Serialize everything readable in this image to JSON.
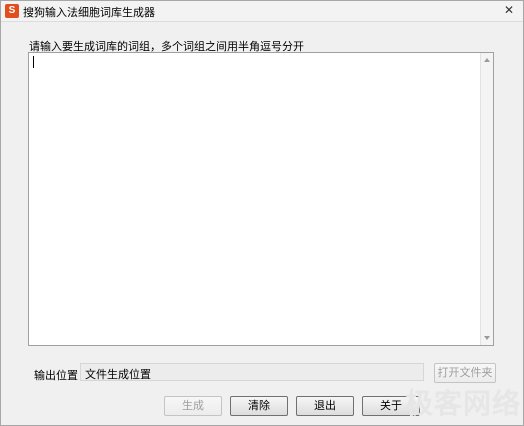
{
  "window": {
    "title": "搜狗输入法细胞词库生成器",
    "app_icon": "S",
    "close_glyph": "✕"
  },
  "main": {
    "prompt_label": "请输入要生成词库的词组，多个词组之间用半角逗号分开",
    "words_value": ""
  },
  "output": {
    "label": "输出位置",
    "path": "文件生成位置",
    "open_folder_label": "打开文件夹"
  },
  "buttons": {
    "generate": "生成",
    "clear": "清除",
    "exit": "退出",
    "about": "关于"
  },
  "watermark": {
    "text": "极客网络"
  },
  "colors": {
    "icon_bg": "#e24f1f",
    "disabled_text": "#9e9e9e"
  }
}
